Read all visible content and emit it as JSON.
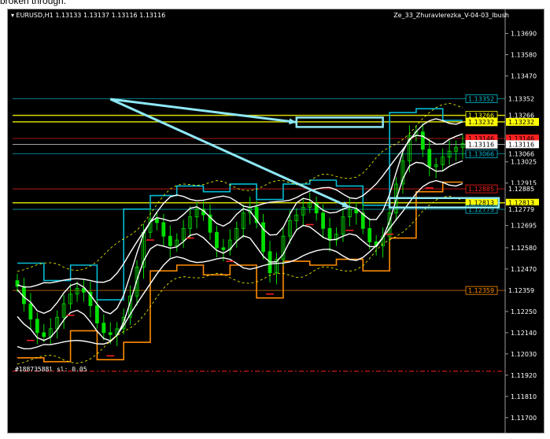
{
  "page": {
    "caption": "broken through."
  },
  "chart": {
    "symbol_header": "▾ EURUSD,H1  1.13133 1.13137 1.13116 1.13116",
    "indicator_header": "Ze_33_Zhuravlerezka_V-04-03_Ibush",
    "order_label": "#18873588l sl: 0.05",
    "colors": {
      "background": "#000000",
      "candles": "#00e000",
      "envelope": "#ffffff",
      "level_yellow": "#ffff00",
      "level_cyan": "#00bcd4",
      "level_red": "#ff2020",
      "level_orange": "#ff8c00",
      "arrow": "#8ee8f4"
    }
  },
  "chart_data": {
    "type": "candlestick",
    "symbol": "EURUSD",
    "timeframe": "H1",
    "ohlc_last": {
      "open": 1.13133,
      "high": 1.13137,
      "low": 1.13116,
      "close": 1.13116
    },
    "ylim": [
      1.1163,
      1.1379
    ],
    "y_ticks": [
      1.1369,
      1.1358,
      1.1347,
      1.1336,
      1.13232,
      1.13146,
      1.13116,
      1.13025,
      1.12915,
      1.12813,
      1.12695,
      1.1258,
      1.1247,
      1.1236,
      1.1225,
      1.1214,
      1.1203,
      1.1192,
      1.1181,
      1.117
    ],
    "price_lines": [
      {
        "price": 1.13352,
        "label": "1.13352",
        "color": "#00bcd4"
      },
      {
        "price": 1.13266,
        "label": "1.13266",
        "color": "#ffff00"
      },
      {
        "price": 1.13232,
        "label": "1.13232",
        "color": "#ffff00"
      },
      {
        "price": 1.13146,
        "label": "1.13146",
        "color": "#ff2020"
      },
      {
        "price": 1.13116,
        "label": "1.13116",
        "color": "#ffffff"
      },
      {
        "price": 1.13066,
        "label": "1.13066",
        "color": "#00bcd4"
      },
      {
        "price": 1.12885,
        "label": "1.12885",
        "color": "#ff2020"
      },
      {
        "price": 1.12813,
        "label": "1.12813",
        "color": "#ffff00"
      },
      {
        "price": 1.12779,
        "label": "1.12779",
        "color": "#00bcd4"
      },
      {
        "price": 1.12359,
        "label": "1.12359",
        "color": "#ff8c00"
      }
    ],
    "closes": [
      1.1238,
      1.1229,
      1.1221,
      1.1214,
      1.1212,
      1.1216,
      1.1222,
      1.1229,
      1.1234,
      1.1237,
      1.1235,
      1.1228,
      1.1219,
      1.1214,
      1.1213,
      1.1216,
      1.1222,
      1.1233,
      1.1248,
      1.1266,
      1.1273,
      1.1271,
      1.1264,
      1.1259,
      1.1262,
      1.1268,
      1.1274,
      1.1278,
      1.1275,
      1.1266,
      1.1258,
      1.1257,
      1.1262,
      1.1268,
      1.1276,
      1.1279,
      1.1271,
      1.1256,
      1.1245,
      1.1252,
      1.1264,
      1.1272,
      1.1275,
      1.1279,
      1.1281,
      1.1276,
      1.1268,
      1.1262,
      1.1265,
      1.1274,
      1.1278,
      1.1276,
      1.1268,
      1.1261,
      1.1259,
      1.1264,
      1.1276,
      1.1291,
      1.1303,
      1.1316,
      1.1318,
      1.1309,
      1.13,
      1.1301,
      1.1305,
      1.1308,
      1.131,
      1.1312
    ]
  }
}
